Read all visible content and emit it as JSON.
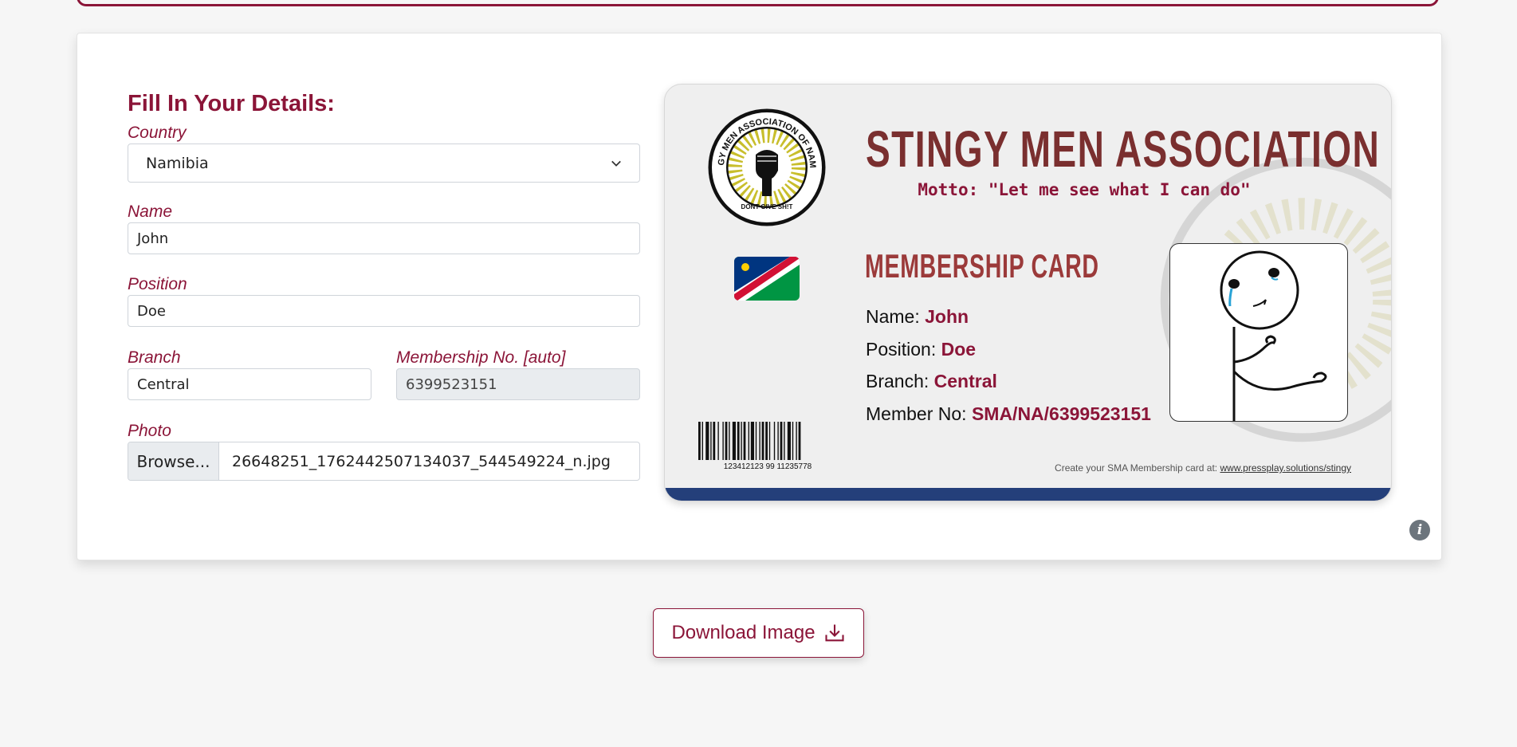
{
  "form": {
    "title": "Fill In Your Details:",
    "country_label": "Country",
    "country_value": "Namibia",
    "name_label": "Name",
    "name_value": "John",
    "position_label": "Position",
    "position_value": "Doe",
    "branch_label": "Branch",
    "branch_value": "Central",
    "membership_label": "Membership No. [auto]",
    "membership_value": "6399523151",
    "photo_label": "Photo",
    "browse_label": "Browse...",
    "file_name": "26648251_1762442507134037_544549224_n.jpg"
  },
  "card": {
    "title": "STINGY MEN ASSOCIATION",
    "motto": "Motto: \"Let me see what I can do\"",
    "membership_title": "MEMBERSHIP CARD",
    "name_label": "Name:",
    "name_value": "John",
    "position_label": "Position:",
    "position_value": "Doe",
    "branch_label": "Branch:",
    "branch_value": "Central",
    "member_no_label": "Member No:",
    "member_no_value": "SMA/NA/6399523151",
    "logo_text_top": "STINGY MEN ASSOCIATION OF NAMIBIA",
    "logo_text_bottom": "DONT GIVE SH!T",
    "barcode_number": "123412123 99 11235778",
    "credit_text": "Create your SMA Membership card at:",
    "credit_link": "www.pressplay.solutions/stingy",
    "bottom_bar_color": "#243f7a"
  },
  "actions": {
    "download_label": "Download Image",
    "info_icon": "i"
  },
  "colors": {
    "accent": "#8b1538",
    "title_brown": "#7a2f2f"
  }
}
